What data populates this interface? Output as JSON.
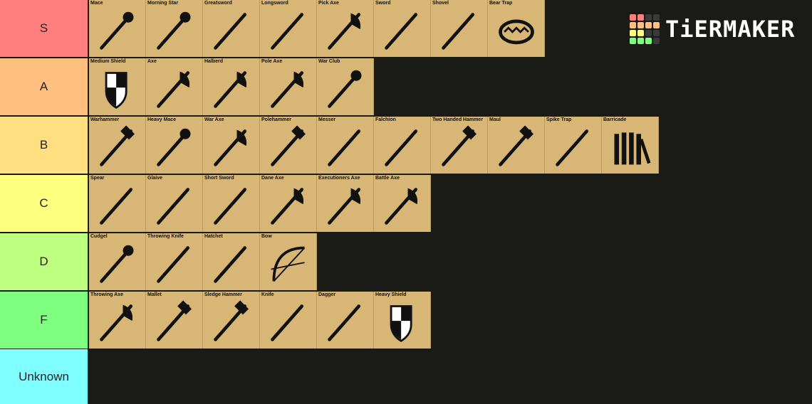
{
  "logo": {
    "text": "TiERMAKER",
    "grid_colors": [
      "#ff7f7f",
      "#ff7f7f",
      "#3a3a3a",
      "#3a3a3a",
      "#ffbf7f",
      "#ffbf7f",
      "#ffbf7f",
      "#ffbf7f",
      "#ffff7f",
      "#ffff7f",
      "#3a3a3a",
      "#3a3a3a",
      "#7fff7f",
      "#7fff7f",
      "#7fff7f",
      "#3a3a3a"
    ]
  },
  "tiers": [
    {
      "label": "S",
      "color": "#ff7f7f",
      "items": [
        "Mace",
        "Morning Star",
        "Greatsword",
        "Longsword",
        "Pick Axe",
        "Sword",
        "Shovel",
        "Bear Trap"
      ]
    },
    {
      "label": "A",
      "color": "#ffbf7f",
      "items": [
        "Medium Shield",
        "Axe",
        "Halberd",
        "Pole Axe",
        "War Club"
      ]
    },
    {
      "label": "B",
      "color": "#ffdf7f",
      "items": [
        "Warhammer",
        "Heavy Mace",
        "War Axe",
        "Polehammer",
        "Messer",
        "Falchion",
        "Two Handed Hammer",
        "Maul",
        "Spike Trap",
        "Barricade"
      ]
    },
    {
      "label": "C",
      "color": "#ffff7f",
      "items": [
        "Spear",
        "Glaive",
        "Short Sword",
        "Dane Axe",
        "Executioners Axe",
        "Battle Axe"
      ]
    },
    {
      "label": "D",
      "color": "#bfff7f",
      "items": [
        "Cudgel",
        "Throwing Knife",
        "Hatchet",
        "Bow"
      ]
    },
    {
      "label": "F",
      "color": "#7fff7f",
      "items": [
        "Throwing Axe",
        "Mallet",
        "Sledge Hammer",
        "Knife",
        "Dagger",
        "Heavy Shield"
      ]
    },
    {
      "label": "Unknown",
      "color": "#7fffff",
      "items": []
    }
  ]
}
